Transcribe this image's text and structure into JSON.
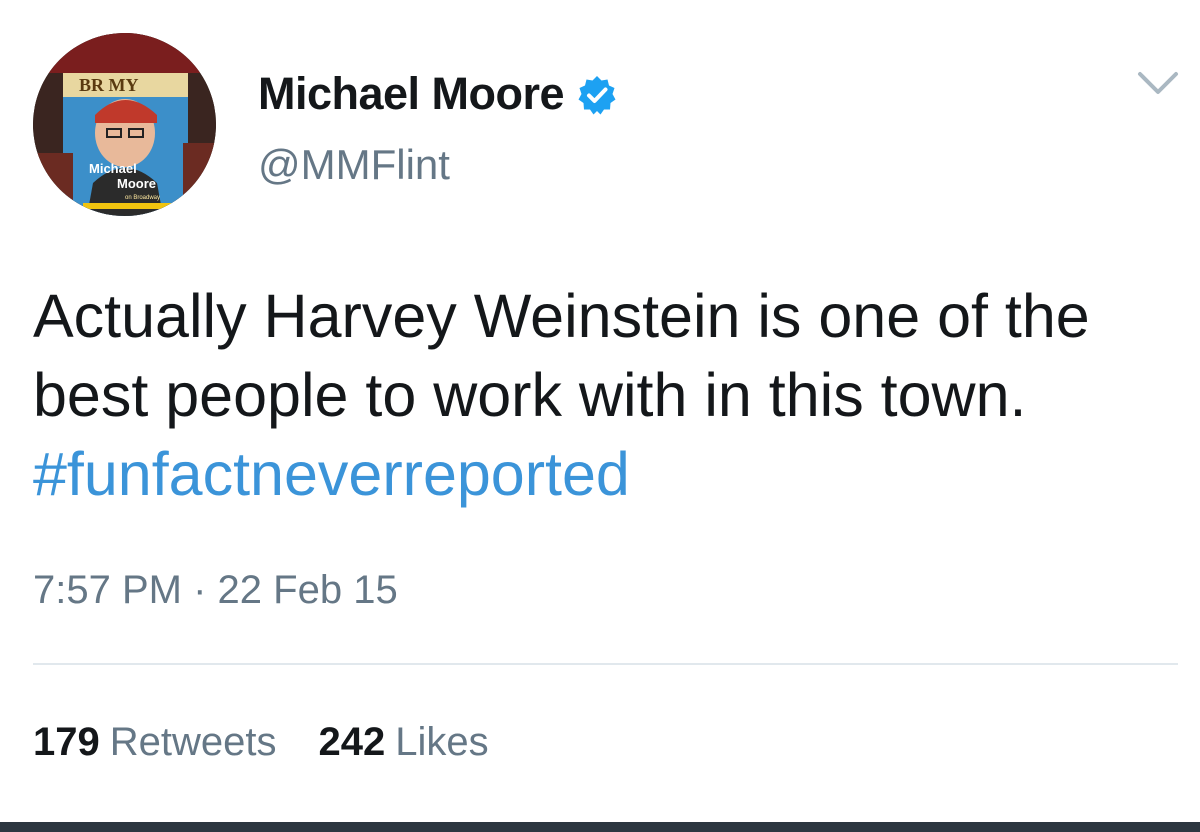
{
  "tweet": {
    "author": {
      "display_name": "Michael Moore",
      "handle": "@MMFlint",
      "verified": true,
      "avatar_text": {
        "poster_top": "BR MY",
        "poster_name_1": "Michael",
        "poster_name_2": "Moore",
        "poster_sub": "on Broadway"
      }
    },
    "text": {
      "body": "Actually Harvey Weinstein is one of the best people to work with in this town. ",
      "hashtag": "#funfactneverreported"
    },
    "time": "7:57 PM",
    "separator": "·",
    "date": "22 Feb 15",
    "stats": {
      "retweets_count": "179",
      "retweets_label": "Retweets",
      "likes_count": "242",
      "likes_label": "Likes"
    },
    "icons": {
      "verified": "verified-badge-icon",
      "menu": "chevron-down-icon"
    },
    "colors": {
      "hashtag": "#3b94d9",
      "verified": "#1da1f2",
      "secondary_text": "#657786",
      "primary_text": "#14171a"
    }
  }
}
